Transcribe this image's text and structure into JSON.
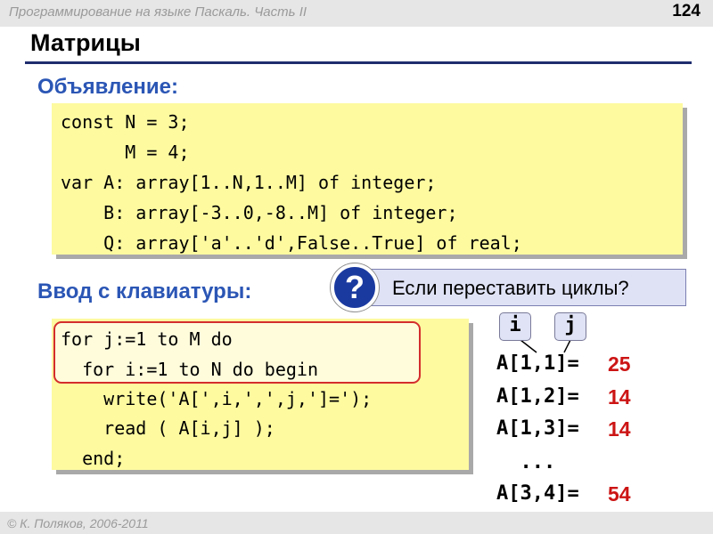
{
  "header": {
    "course_title": "Программирование на языке Паскаль. Часть II",
    "slide_number": "124"
  },
  "slide_title": "Матрицы",
  "declaration": {
    "heading": "Объявление:",
    "lines": [
      "const N = 3;",
      "      M = 4;",
      "var A: array[1..N,1..M] of integer;",
      "    B: array[-3..0,-8..M] of integer;",
      "    Q: array['a'..'d',False..True] of real;"
    ]
  },
  "input": {
    "heading": "Ввод с клавиатуры:",
    "lines": [
      "for j:=1 to M do",
      "  for i:=1 to N do begin",
      "    write('A[',i,',',j,']=');",
      "    read ( A[i,j] );",
      "  end;"
    ]
  },
  "question": {
    "badge": "?",
    "text": "Если переставить циклы?"
  },
  "indices": {
    "i": "i",
    "j": "j"
  },
  "results": [
    {
      "label": "A[1,1]=",
      "value": "25"
    },
    {
      "label": "A[1,2]=",
      "value": "14"
    },
    {
      "label": "A[1,3]=",
      "value": "14"
    },
    {
      "label": "  ...",
      "value": ""
    },
    {
      "label": "A[3,4]=",
      "value": "54"
    }
  ],
  "footer": {
    "copyright": "© К. Поляков, 2006-2011"
  }
}
